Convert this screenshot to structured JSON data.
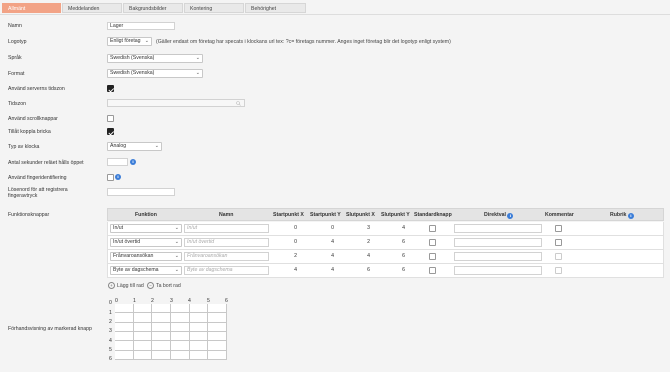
{
  "tabs": [
    "Allmänt",
    "Meddelanden",
    "Bakgrundsbilder",
    "Kontering",
    "Behörighet"
  ],
  "form": {
    "name_label": "Namn",
    "name_value": "Lager",
    "logo_label": "Logotyp",
    "logo_value": "Enligt företag",
    "logo_hint": "(Gäller endast om företag har specats i klockans url tex: ?c= företags nummer. Anges inget företag blir det logotyp enligt system)",
    "language_label": "Språk",
    "language_value": "Swedish (Svenska)",
    "format_label": "Format",
    "format_value": "Swedish (Svenska)",
    "server_tz_label": "Använd serverns tidszon",
    "server_tz_checked": true,
    "timezone_label": "Tidszon",
    "timezone_value": "",
    "scroll_label": "Använd scrollknappar",
    "scroll_checked": false,
    "badge_label": "Tillåt koppla bricka",
    "badge_checked": true,
    "clock_type_label": "Typ av klocka",
    "clock_type_value": "Analog",
    "seconds_label": "Antal sekunder reläet hålls öppet",
    "seconds_value": "",
    "fingerprint_label": "Använd fingeridentifiering",
    "fingerprint_checked": false,
    "password_label_1": "Lösenord för att registrera",
    "password_label_2": "fingeravtryck",
    "password_value": "",
    "function_buttons_label": "Funktionsknappar",
    "preview_label": "Förhandsvisning av markerad knapp"
  },
  "table": {
    "headers": {
      "funktion": "Funktion",
      "namn": "Namn",
      "sx": "Startpunkt X",
      "sy": "Startpunkt Y",
      "ex": "Slutpunkt X",
      "ey": "Slutpunkt Y",
      "std": "Standardknapp",
      "direktval": "Direktval",
      "kommentar": "Kommentar",
      "rubrik": "Rubrik"
    },
    "rows": [
      {
        "funktion": "In/ut",
        "namn_placeholder": "In/ut",
        "sx": "0",
        "sy": "0",
        "ex": "3",
        "ey": "4"
      },
      {
        "funktion": "In/ut övertid",
        "namn_placeholder": "In/ut övertid",
        "sx": "0",
        "sy": "4",
        "ex": "2",
        "ey": "6"
      },
      {
        "funktion": "Frånvaroansökan",
        "namn_placeholder": "Frånvaroansökan",
        "sx": "2",
        "sy": "4",
        "ex": "4",
        "ey": "6"
      },
      {
        "funktion": "Byte av dagschema",
        "namn_placeholder": "Byte av dagschema",
        "sx": "4",
        "sy": "4",
        "ex": "6",
        "ey": "6"
      }
    ],
    "add_row": "Lägg till rad",
    "remove_row": "Ta bort rad"
  },
  "preview": {
    "x_ticks": [
      "0",
      "1",
      "2",
      "3",
      "4",
      "5",
      "6"
    ],
    "y_ticks": [
      "0",
      "1",
      "2",
      "3",
      "4",
      "5",
      "6"
    ]
  },
  "icons": {
    "info": "info-icon",
    "chevron": "chevron-down-icon",
    "search": "search-icon",
    "plus": "plus-circle-icon",
    "minus": "minus-circle-icon"
  },
  "colors": {
    "active_tab": "#f2a386",
    "info": "#3b7dd8"
  }
}
